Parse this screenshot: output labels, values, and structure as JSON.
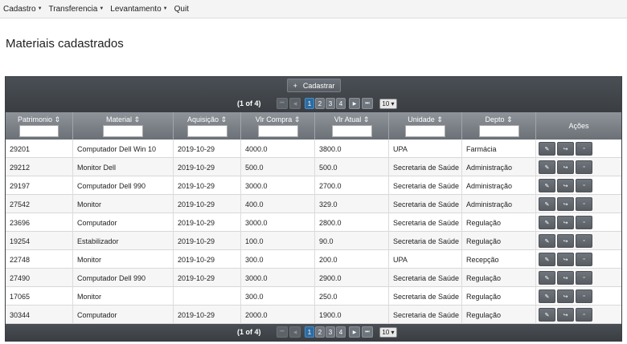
{
  "menu": {
    "items": [
      {
        "label": "Cadastro",
        "caret": true
      },
      {
        "label": "Transferencia",
        "caret": true
      },
      {
        "label": "Levantamento",
        "caret": true
      },
      {
        "label": "Quit",
        "caret": false
      }
    ]
  },
  "page": {
    "title": "Materiais cadastrados"
  },
  "toolbar": {
    "cadastrar_label": "Cadastrar",
    "cadastrar_icon": "plus-icon"
  },
  "paginator": {
    "current": "(1 of 4)",
    "pages": [
      "1",
      "2",
      "3",
      "4"
    ],
    "selected_page": "1",
    "rows_per_page": "10 ▾",
    "nav_icons": [
      "first-page-icon",
      "prev-page-icon",
      "next-page-icon",
      "last-page-icon"
    ]
  },
  "table": {
    "columns": [
      {
        "label": "Patrimonio ⇕",
        "filter": true
      },
      {
        "label": "Material ⇕",
        "filter": true
      },
      {
        "label": "Aquisição ⇕",
        "filter": true
      },
      {
        "label": "Vlr Compra ⇕",
        "filter": true
      },
      {
        "label": "Vlr Atual ⇕",
        "filter": true
      },
      {
        "label": "Unidade ⇕",
        "filter": true
      },
      {
        "label": "Depto ⇕",
        "filter": true
      },
      {
        "label": "Ações",
        "filter": false
      }
    ],
    "rows": [
      [
        "29201",
        "Computador Dell Win 10",
        "2019-10-29",
        "4000.0",
        "3800.0",
        "UPA",
        "Farmácia"
      ],
      [
        "29212",
        "Monitor Dell",
        "2019-10-29",
        "500.0",
        "500.0",
        "Secretaria de Saúde",
        "Administração"
      ],
      [
        "29197",
        "Computador Dell 990",
        "2019-10-29",
        "3000.0",
        "2700.0",
        "Secretaria de Saúde",
        "Administração"
      ],
      [
        "27542",
        "Monitor",
        "2019-10-29",
        "400.0",
        "329.0",
        "Secretaria de Saúde",
        "Administração"
      ],
      [
        "23696",
        "Computador",
        "2019-10-29",
        "3000.0",
        "2800.0",
        "Secretaria de Saúde",
        "Regulação"
      ],
      [
        "19254",
        "Estabilizador",
        "2019-10-29",
        "100.0",
        "90.0",
        "Secretaria de Saúde",
        "Regulação"
      ],
      [
        "22748",
        "Monitor",
        "2019-10-29",
        "300.0",
        "200.0",
        "UPA",
        "Recepção"
      ],
      [
        "27490",
        "Computador Dell 990",
        "2019-10-29",
        "3000.0",
        "2900.0",
        "Secretaria de Saúde",
        "Regulação"
      ],
      [
        "17065",
        "Monitor",
        "",
        "300.0",
        "250.0",
        "Secretaria de Saúde",
        "Regulação"
      ],
      [
        "30344",
        "Computador",
        "2019-10-29",
        "2000.0",
        "1900.0",
        "Secretaria de Saúde",
        "Regulação"
      ]
    ],
    "action_icons": [
      "edit-icon",
      "transfer-icon",
      "delete-icon"
    ],
    "action_glyphs": [
      "✎",
      "↪",
      "▫"
    ]
  }
}
